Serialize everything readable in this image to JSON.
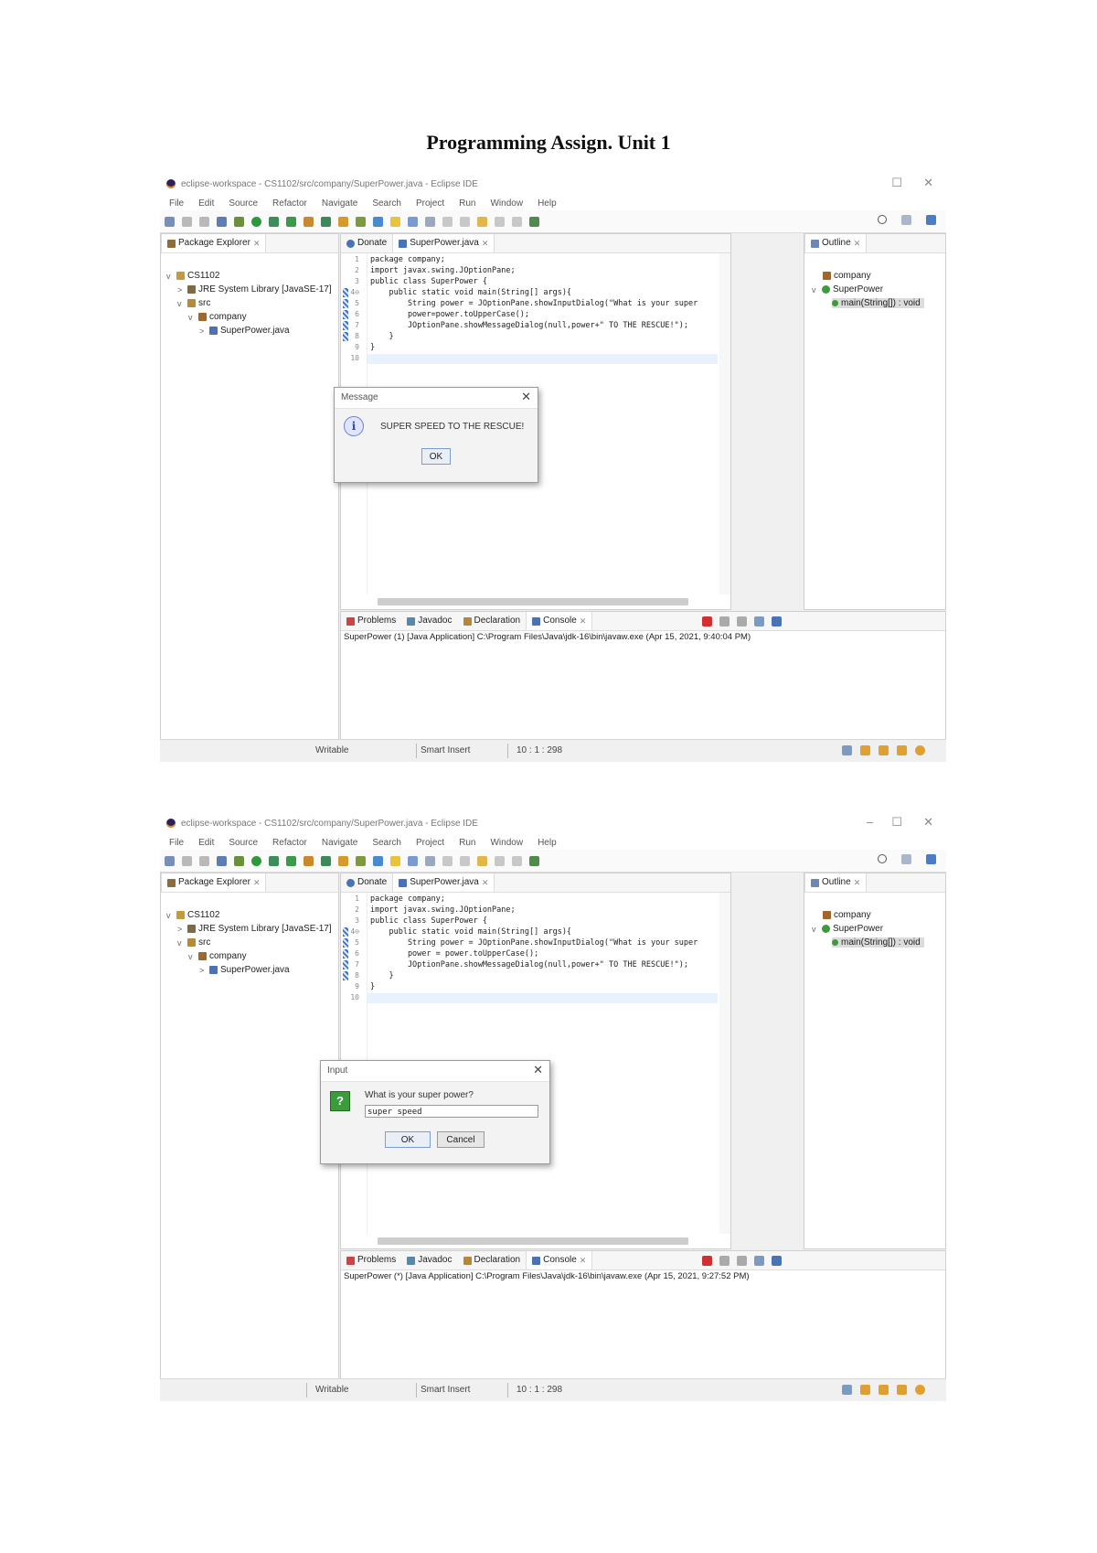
{
  "document": {
    "title": "Programming Assign. Unit 1"
  },
  "screens": [
    {
      "window_title": "eclipse-workspace - CS1102/src/company/SuperPower.java - Eclipse IDE",
      "menu": [
        "File",
        "Edit",
        "Source",
        "Refactor",
        "Navigate",
        "Search",
        "Project",
        "Run",
        "Window",
        "Help"
      ],
      "package_explorer": {
        "tab": "Package Explorer",
        "tree": [
          "CS1102",
          "JRE System Library [JavaSE-17]",
          "src",
          "company",
          "SuperPower.java"
        ]
      },
      "editor": {
        "tabs": [
          "Donate",
          "SuperPower.java"
        ],
        "line_numbers": [
          "1",
          "2",
          "3",
          "4⊖",
          "5",
          "6",
          "7",
          "8",
          "9",
          "10"
        ],
        "code": [
          "package company;",
          "import javax.swing.JOptionPane;",
          "public class SuperPower {",
          "    public static void main(String[] args){",
          "        String power = JOptionPane.showInputDialog(\"What is your super",
          "        power=power.toUpperCase();",
          "        JOptionPane.showMessageDialog(null,power+\" TO THE RESCUE!\");",
          "    }",
          "}",
          ""
        ]
      },
      "outline": {
        "tab": "Outline",
        "items": [
          "company",
          "SuperPower",
          "main(String[]) : void"
        ]
      },
      "bottom_tabs": [
        "Problems",
        "Javadoc",
        "Declaration",
        "Console"
      ],
      "console_header": "SuperPower (1) [Java Application] C:\\Program Files\\Java\\jdk-16\\bin\\javaw.exe (Apr 15, 2021, 9:40:04 PM)",
      "dialog": {
        "title": "Message",
        "message": "SUPER SPEED TO THE RESCUE!",
        "ok_label": "OK"
      },
      "status": {
        "writable": "Writable",
        "insert": "Smart Insert",
        "position": "10 : 1 : 298"
      }
    },
    {
      "window_title": "eclipse-workspace - CS1102/src/company/SuperPower.java - Eclipse IDE",
      "menu": [
        "File",
        "Edit",
        "Source",
        "Refactor",
        "Navigate",
        "Search",
        "Project",
        "Run",
        "Window",
        "Help"
      ],
      "package_explorer": {
        "tab": "Package Explorer",
        "tree": [
          "CS1102",
          "JRE System Library [JavaSE-17]",
          "src",
          "company",
          "SuperPower.java"
        ]
      },
      "editor": {
        "tabs": [
          "Donate",
          "SuperPower.java"
        ],
        "line_numbers": [
          "1",
          "2",
          "3",
          "4⊖",
          "5",
          "6",
          "7",
          "8",
          "9",
          "10"
        ],
        "code": [
          "package company;",
          "import javax.swing.JOptionPane;",
          "public class SuperPower {",
          "    public static void main(String[] args){",
          "        String power = JOptionPane.showInputDialog(\"What is your super",
          "        power = power.toUpperCase();",
          "        JOptionPane.showMessageDialog(null,power+\" TO THE RESCUE!\");",
          "    }",
          "}",
          ""
        ]
      },
      "outline": {
        "tab": "Outline",
        "items": [
          "company",
          "SuperPower",
          "main(String[]) : void"
        ]
      },
      "bottom_tabs": [
        "Problems",
        "Javadoc",
        "Declaration",
        "Console"
      ],
      "console_header": "SuperPower (*) [Java Application] C:\\Program Files\\Java\\jdk-16\\bin\\javaw.exe (Apr 15, 2021, 9:27:52 PM)",
      "dialog": {
        "title": "Input",
        "prompt": "What is your super power?",
        "input_value": "super speed",
        "ok_label": "OK",
        "cancel_label": "Cancel"
      },
      "status": {
        "writable": "Writable",
        "insert": "Smart Insert",
        "position": "10 : 1 : 298"
      }
    }
  ]
}
